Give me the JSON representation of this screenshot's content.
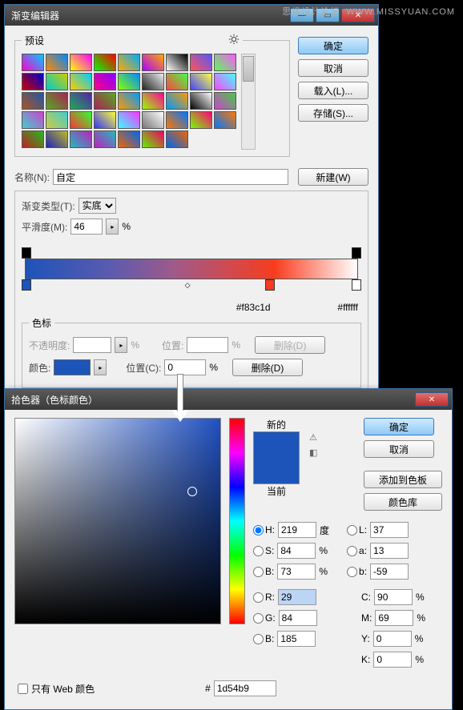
{
  "watermark_site": "WWW.MISSYUAN.COM",
  "watermark_forum": "思缘设计论坛",
  "gradient_editor": {
    "title": "渐变编辑器",
    "presets_label": "预设",
    "ok": "确定",
    "cancel": "取消",
    "load": "载入(L)...",
    "save": "存储(S)...",
    "name_label": "名称(N):",
    "name_value": "自定",
    "new_btn": "新建(W)",
    "gradient_type_label": "渐变类型(T):",
    "gradient_type_value": "实底",
    "smoothness_label": "平滑度(M):",
    "smoothness_value": "46",
    "percent": "%",
    "stops_label": "色标",
    "stop_colors": {
      "red": "#f83c1d",
      "white": "#ffffff"
    },
    "opacity_label": "不透明度:",
    "location_label": "位置:",
    "delete_label": "删除(D)",
    "color_label": "颜色:",
    "position_label": "位置(C):",
    "position_value": "0"
  },
  "color_picker": {
    "title": "拾色器（色标颜色）",
    "new_label": "新的",
    "current_label": "当前",
    "ok": "确定",
    "cancel": "取消",
    "add_swatch": "添加到色板",
    "color_libs": "颜色库",
    "fields": {
      "H": {
        "label": "H:",
        "value": "219",
        "unit": "度"
      },
      "S": {
        "label": "S:",
        "value": "84",
        "unit": "%"
      },
      "B": {
        "label": "B:",
        "value": "73",
        "unit": "%"
      },
      "R": {
        "label": "R:",
        "value": "29"
      },
      "G": {
        "label": "G:",
        "value": "84"
      },
      "Bb": {
        "label": "B:",
        "value": "185"
      },
      "L": {
        "label": "L:",
        "value": "37"
      },
      "a": {
        "label": "a:",
        "value": "13"
      },
      "b": {
        "label": "b:",
        "value": "-59"
      },
      "C": {
        "label": "C:",
        "value": "90",
        "unit": "%"
      },
      "M": {
        "label": "M:",
        "value": "69",
        "unit": "%"
      },
      "Y": {
        "label": "Y:",
        "value": "0",
        "unit": "%"
      },
      "K": {
        "label": "K:",
        "value": "0",
        "unit": "%"
      }
    },
    "web_only": "只有 Web 颜色",
    "hex_label": "#",
    "hex_value": "1d54b9"
  }
}
